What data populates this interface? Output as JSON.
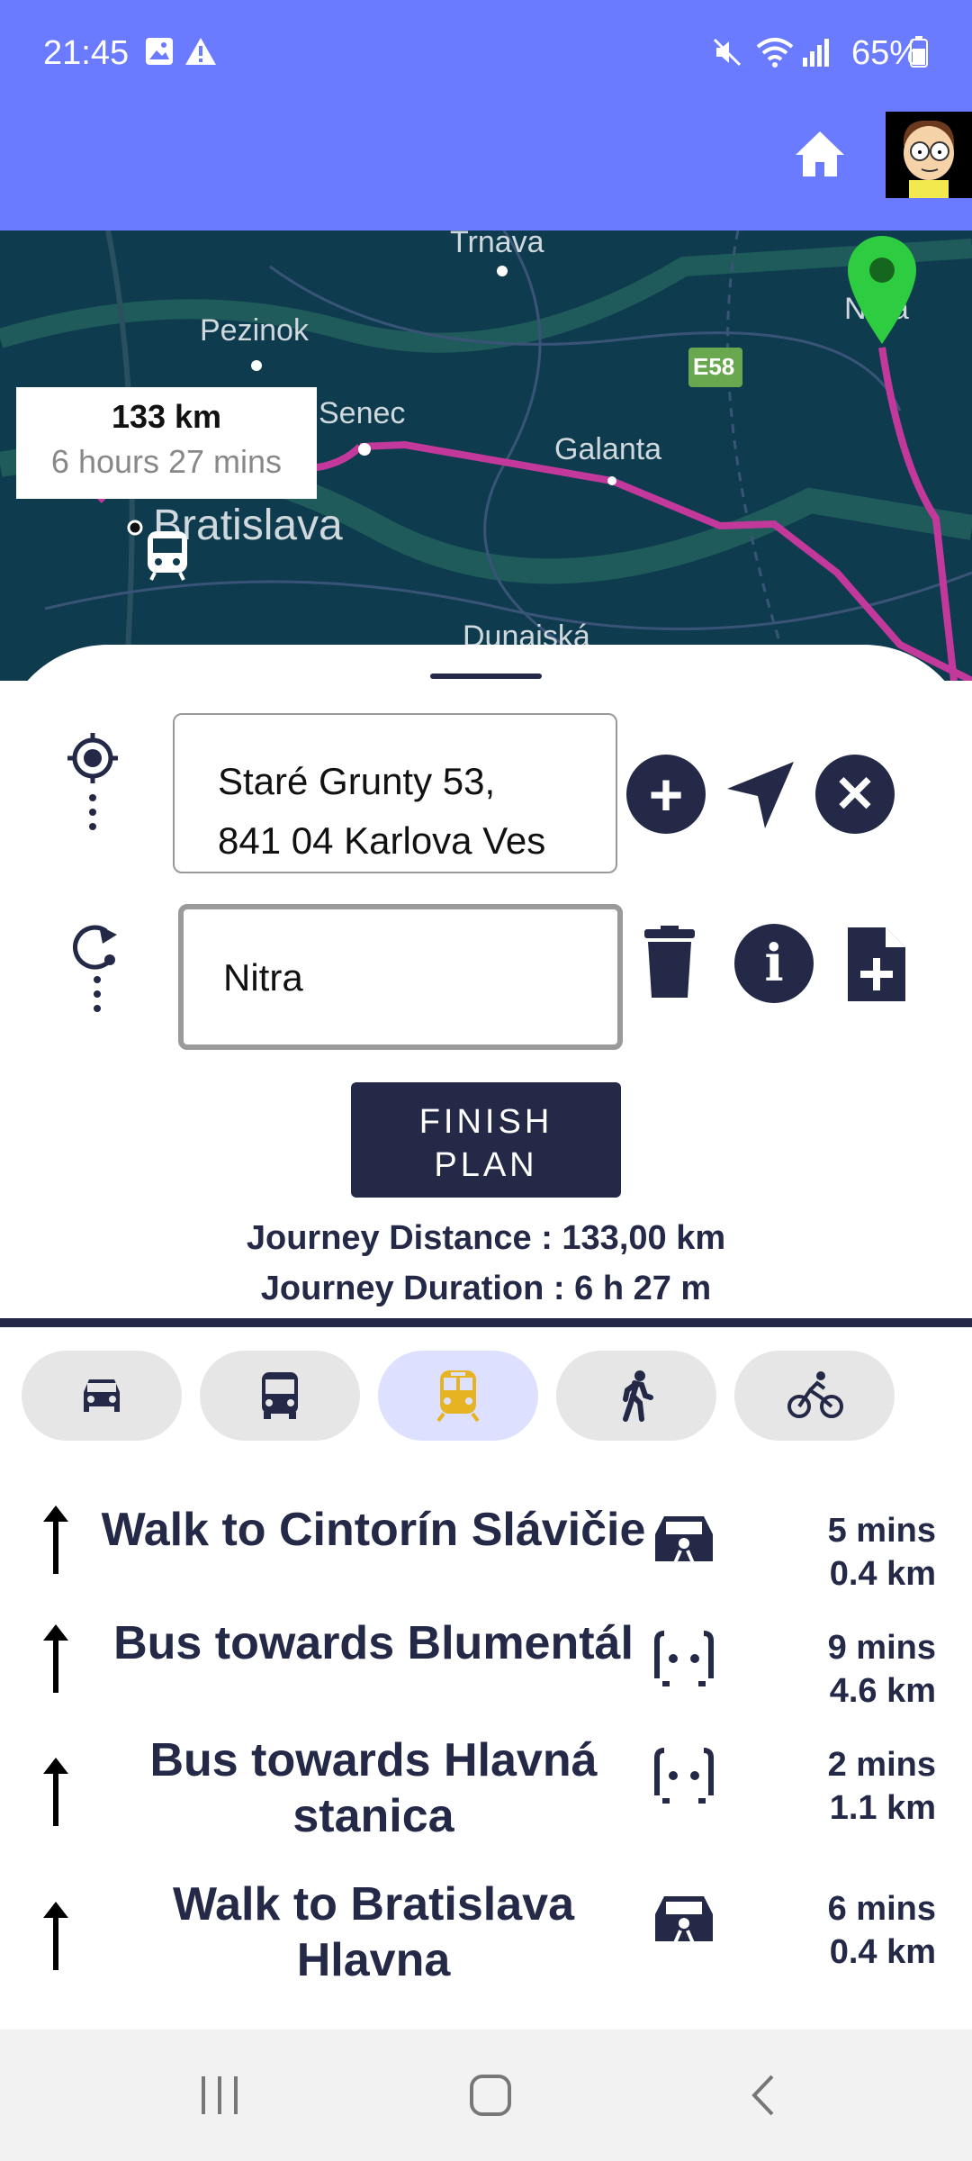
{
  "status": {
    "time": "21:45",
    "battery": "65%"
  },
  "map": {
    "labels": {
      "trnava": "Trnava",
      "pezinok": "Pezinok",
      "senec": "Senec",
      "galanta": "Galanta",
      "bratislava": "Bratislava",
      "dunajska": "Dunajská",
      "nitra": "Nitra",
      "road": "E58"
    },
    "route_card": {
      "distance": "133 km",
      "duration": "6 hours 27 mins"
    }
  },
  "planner": {
    "start_value": "Staré Grunty 53,",
    "start_value_line2": "841 04 Karlova Ves",
    "dest_value": "Nitra",
    "finish_label_1": "FINISH",
    "finish_label_2": "PLAN",
    "journey_distance": "Journey Distance : 133,00 km",
    "journey_duration": "Journey Duration : 6 h 27 m"
  },
  "modes": [
    "car",
    "bus",
    "train",
    "walk",
    "bike"
  ],
  "active_mode": "train",
  "steps": [
    {
      "label": "Walk to Cintorín Slávičie",
      "time": "5 mins",
      "dist": "0.4 km"
    },
    {
      "label": "Bus towards Blumentál",
      "time": "9 mins",
      "dist": "4.6 km"
    },
    {
      "label": "Bus towards Hlavná stanica",
      "time": "2 mins",
      "dist": "1.1 km"
    },
    {
      "label": "Walk to Bratislava Hlavna",
      "time": "6 mins",
      "dist": "0.4 km"
    }
  ],
  "colors": {
    "primary": "#6b7bff",
    "navy": "#232946",
    "route": "#c2399b",
    "pin": "#2ecc40"
  }
}
